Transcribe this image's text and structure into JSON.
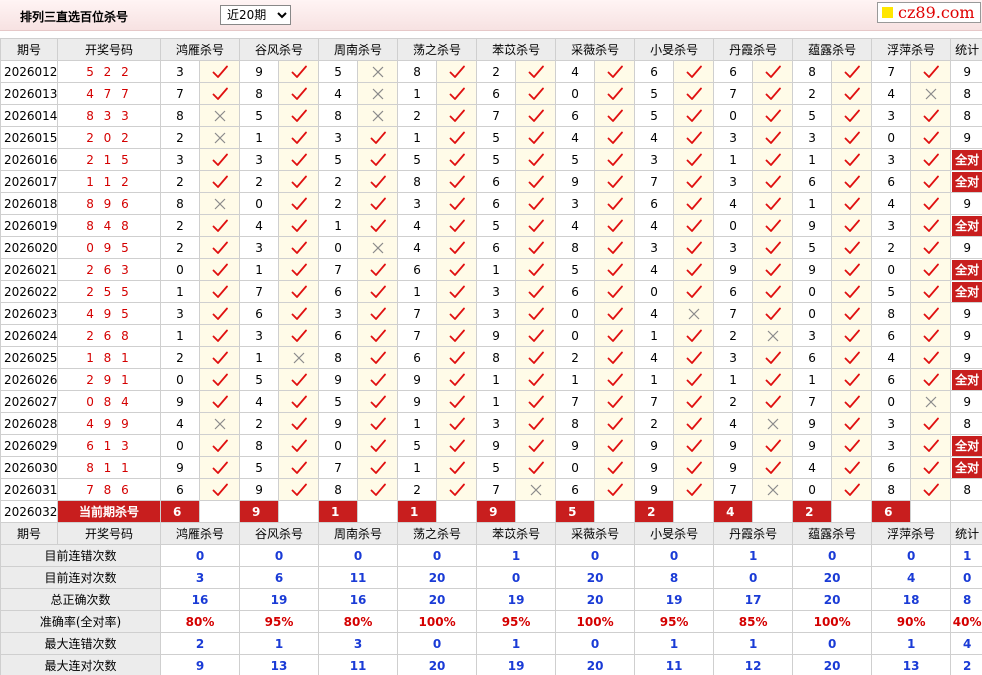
{
  "header": {
    "title": "排列三直选百位杀号",
    "period_selected": "近20期",
    "period_options": [
      "近20期"
    ],
    "site_logo": "cz89.com"
  },
  "columns": {
    "issue": "期号",
    "draw": "开奖号码",
    "count": "统计",
    "experts": [
      "鸿雁杀号",
      "谷风杀号",
      "周南杀号",
      "荡之杀号",
      "苯苡杀号",
      "采薇杀号",
      "小旻杀号",
      "丹霞杀号",
      "蕴露杀号",
      "浮萍杀号"
    ]
  },
  "all_right_label": "全对",
  "rows": [
    {
      "issue": "2026012",
      "draw": "5 2 2",
      "kills": [
        3,
        9,
        5,
        8,
        2,
        4,
        6,
        6,
        8,
        7
      ],
      "ok": [
        1,
        1,
        0,
        1,
        1,
        1,
        1,
        1,
        1,
        1
      ],
      "count": "9"
    },
    {
      "issue": "2026013",
      "draw": "4 7 7",
      "kills": [
        7,
        8,
        4,
        1,
        6,
        0,
        5,
        7,
        2,
        4
      ],
      "ok": [
        1,
        1,
        0,
        1,
        1,
        1,
        1,
        1,
        1,
        0
      ],
      "count": "8"
    },
    {
      "issue": "2026014",
      "draw": "8 3 3",
      "kills": [
        8,
        5,
        8,
        2,
        7,
        6,
        5,
        0,
        5,
        3
      ],
      "ok": [
        0,
        1,
        0,
        1,
        1,
        1,
        1,
        1,
        1,
        1
      ],
      "count": "8"
    },
    {
      "issue": "2026015",
      "draw": "2 0 2",
      "kills": [
        2,
        1,
        3,
        1,
        5,
        4,
        4,
        3,
        3,
        0
      ],
      "ok": [
        0,
        1,
        1,
        1,
        1,
        1,
        1,
        1,
        1,
        1
      ],
      "count": "9"
    },
    {
      "issue": "2026016",
      "draw": "2 1 5",
      "kills": [
        3,
        3,
        5,
        5,
        5,
        5,
        3,
        1,
        1,
        3
      ],
      "ok": [
        1,
        1,
        1,
        1,
        1,
        1,
        1,
        1,
        1,
        1
      ],
      "count": "全对"
    },
    {
      "issue": "2026017",
      "draw": "1 1 2",
      "kills": [
        2,
        2,
        2,
        8,
        6,
        9,
        7,
        3,
        6,
        6
      ],
      "ok": [
        1,
        1,
        1,
        1,
        1,
        1,
        1,
        1,
        1,
        1
      ],
      "count": "全对"
    },
    {
      "issue": "2026018",
      "draw": "8 9 6",
      "kills": [
        8,
        0,
        2,
        3,
        6,
        3,
        6,
        4,
        1,
        4
      ],
      "ok": [
        0,
        1,
        1,
        1,
        1,
        1,
        1,
        1,
        1,
        1
      ],
      "count": "9"
    },
    {
      "issue": "2026019",
      "draw": "8 4 8",
      "kills": [
        2,
        4,
        1,
        4,
        5,
        4,
        4,
        0,
        9,
        3
      ],
      "ok": [
        1,
        1,
        1,
        1,
        1,
        1,
        1,
        1,
        1,
        1
      ],
      "count": "全对"
    },
    {
      "issue": "2026020",
      "draw": "0 9 5",
      "kills": [
        2,
        3,
        0,
        4,
        6,
        8,
        3,
        3,
        5,
        2
      ],
      "ok": [
        1,
        1,
        0,
        1,
        1,
        1,
        1,
        1,
        1,
        1
      ],
      "count": "9"
    },
    {
      "issue": "2026021",
      "draw": "2 6 3",
      "kills": [
        0,
        1,
        7,
        6,
        1,
        5,
        4,
        9,
        9,
        0
      ],
      "ok": [
        1,
        1,
        1,
        1,
        1,
        1,
        1,
        1,
        1,
        1
      ],
      "count": "全对"
    },
    {
      "issue": "2026022",
      "draw": "2 5 5",
      "kills": [
        1,
        7,
        6,
        1,
        3,
        6,
        0,
        6,
        0,
        5
      ],
      "ok": [
        1,
        1,
        1,
        1,
        1,
        1,
        1,
        1,
        1,
        1
      ],
      "count": "全对"
    },
    {
      "issue": "2026023",
      "draw": "4 9 5",
      "kills": [
        3,
        6,
        3,
        7,
        3,
        0,
        4,
        7,
        0,
        8
      ],
      "ok": [
        1,
        1,
        1,
        1,
        1,
        1,
        0,
        1,
        1,
        1
      ],
      "count": "9"
    },
    {
      "issue": "2026024",
      "draw": "2 6 8",
      "kills": [
        1,
        3,
        6,
        7,
        9,
        0,
        1,
        2,
        3,
        6
      ],
      "ok": [
        1,
        1,
        1,
        1,
        1,
        1,
        1,
        0,
        1,
        1
      ],
      "count": "9"
    },
    {
      "issue": "2026025",
      "draw": "1 8 1",
      "kills": [
        2,
        1,
        8,
        6,
        8,
        2,
        4,
        3,
        6,
        4
      ],
      "ok": [
        1,
        0,
        1,
        1,
        1,
        1,
        1,
        1,
        1,
        1
      ],
      "count": "9"
    },
    {
      "issue": "2026026",
      "draw": "2 9 1",
      "kills": [
        0,
        5,
        9,
        9,
        1,
        1,
        1,
        1,
        1,
        6
      ],
      "ok": [
        1,
        1,
        1,
        1,
        1,
        1,
        1,
        1,
        1,
        1
      ],
      "count": "全对"
    },
    {
      "issue": "2026027",
      "draw": "0 8 4",
      "kills": [
        9,
        4,
        5,
        9,
        1,
        7,
        7,
        2,
        7,
        0
      ],
      "ok": [
        1,
        1,
        1,
        1,
        1,
        1,
        1,
        1,
        1,
        0
      ],
      "count": "9"
    },
    {
      "issue": "2026028",
      "draw": "4 9 9",
      "kills": [
        4,
        2,
        9,
        1,
        3,
        8,
        2,
        4,
        9,
        3
      ],
      "ok": [
        0,
        1,
        1,
        1,
        1,
        1,
        1,
        0,
        1,
        1
      ],
      "count": "8"
    },
    {
      "issue": "2026029",
      "draw": "6 1 3",
      "kills": [
        0,
        8,
        0,
        5,
        9,
        9,
        9,
        9,
        9,
        3
      ],
      "ok": [
        1,
        1,
        1,
        1,
        1,
        1,
        1,
        1,
        1,
        1
      ],
      "count": "全对"
    },
    {
      "issue": "2026030",
      "draw": "8 1 1",
      "kills": [
        9,
        5,
        7,
        1,
        5,
        0,
        9,
        9,
        4,
        6
      ],
      "ok": [
        1,
        1,
        1,
        1,
        1,
        1,
        1,
        1,
        1,
        1
      ],
      "count": "全对"
    },
    {
      "issue": "2026031",
      "draw": "7 8 6",
      "kills": [
        6,
        9,
        8,
        2,
        7,
        6,
        9,
        7,
        0,
        8
      ],
      "ok": [
        1,
        1,
        1,
        1,
        0,
        1,
        1,
        0,
        1,
        1
      ],
      "count": "8"
    }
  ],
  "current": {
    "issue": "2026032",
    "label": "当前期杀号",
    "kills": [
      "6",
      "9",
      "1",
      "1",
      "9",
      "5",
      "2",
      "4",
      "2",
      "6"
    ]
  },
  "stats": [
    {
      "label": "目前连错次数",
      "values": [
        "0",
        "0",
        "0",
        "0",
        "1",
        "0",
        "0",
        "1",
        "0",
        "0"
      ],
      "total": "1",
      "rate": false
    },
    {
      "label": "目前连对次数",
      "values": [
        "3",
        "6",
        "11",
        "20",
        "0",
        "20",
        "8",
        "0",
        "20",
        "4"
      ],
      "total": "0",
      "rate": false
    },
    {
      "label": "总正确次数",
      "values": [
        "16",
        "19",
        "16",
        "20",
        "19",
        "20",
        "19",
        "17",
        "20",
        "18"
      ],
      "total": "8",
      "rate": false
    },
    {
      "label": "准确率(全对率)",
      "values": [
        "80%",
        "95%",
        "80%",
        "100%",
        "95%",
        "100%",
        "95%",
        "85%",
        "100%",
        "90%"
      ],
      "total": "40%",
      "rate": true
    },
    {
      "label": "最大连错次数",
      "values": [
        "2",
        "1",
        "3",
        "0",
        "1",
        "0",
        "1",
        "1",
        "0",
        "1"
      ],
      "total": "4",
      "rate": false
    },
    {
      "label": "最大连对次数",
      "values": [
        "9",
        "13",
        "11",
        "20",
        "19",
        "20",
        "11",
        "12",
        "20",
        "13"
      ],
      "total": "2",
      "rate": false
    }
  ]
}
